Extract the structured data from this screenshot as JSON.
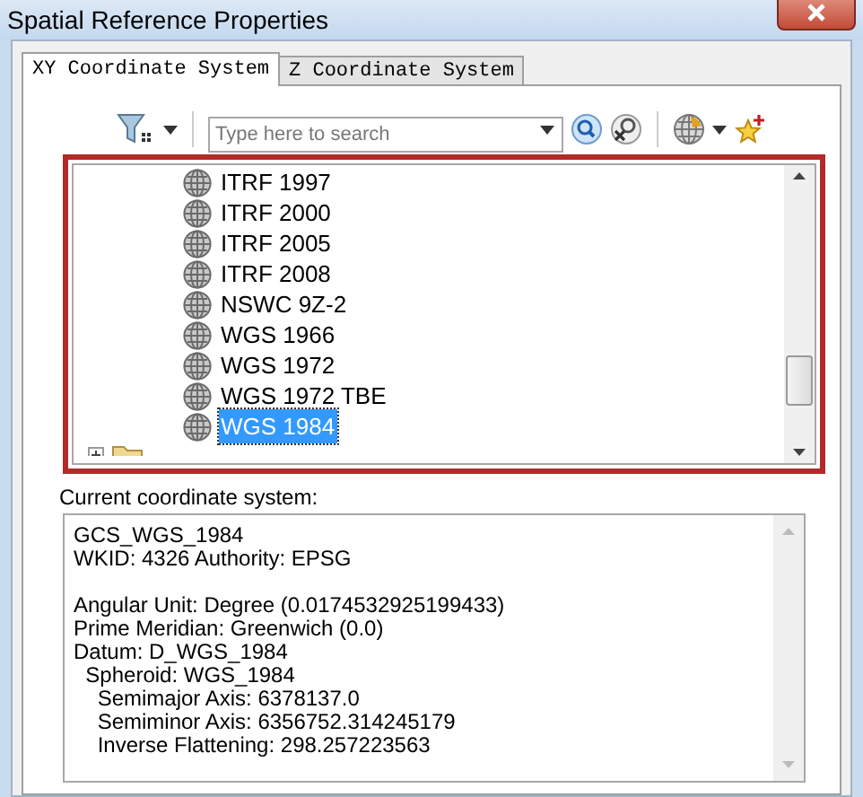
{
  "window": {
    "title": "Spatial Reference Properties"
  },
  "tabs": [
    {
      "label": "XY Coordinate System",
      "selected": true
    },
    {
      "label": "Z Coordinate System",
      "selected": false
    }
  ],
  "search": {
    "placeholder": "Type here to search"
  },
  "tree": {
    "items": [
      {
        "kind": "system",
        "label": "ITRF 1997",
        "selected": false
      },
      {
        "kind": "system",
        "label": "ITRF 2000",
        "selected": false
      },
      {
        "kind": "system",
        "label": "ITRF 2005",
        "selected": false
      },
      {
        "kind": "system",
        "label": "ITRF 2008",
        "selected": false
      },
      {
        "kind": "system",
        "label": "NSWC 9Z-2",
        "selected": false
      },
      {
        "kind": "system",
        "label": "WGS 1966",
        "selected": false
      },
      {
        "kind": "system",
        "label": "WGS 1972",
        "selected": false
      },
      {
        "kind": "system",
        "label": "WGS 1972 TBE",
        "selected": false
      },
      {
        "kind": "system",
        "label": "WGS 1984",
        "selected": true
      }
    ]
  },
  "details": {
    "label": "Current coordinate system:",
    "paragraphs": [
      [
        "GCS_WGS_1984",
        "WKID: 4326 Authority: EPSG"
      ],
      [
        "Angular Unit: Degree (0.0174532925199433)",
        "Prime Meridian: Greenwich (0.0)",
        "Datum: D_WGS_1984",
        "  Spheroid: WGS_1984",
        "    Semimajor Axis: 6378137.0",
        "    Semiminor Axis: 6356752.314245179",
        "    Inverse Flattening: 298.257223563"
      ]
    ]
  }
}
